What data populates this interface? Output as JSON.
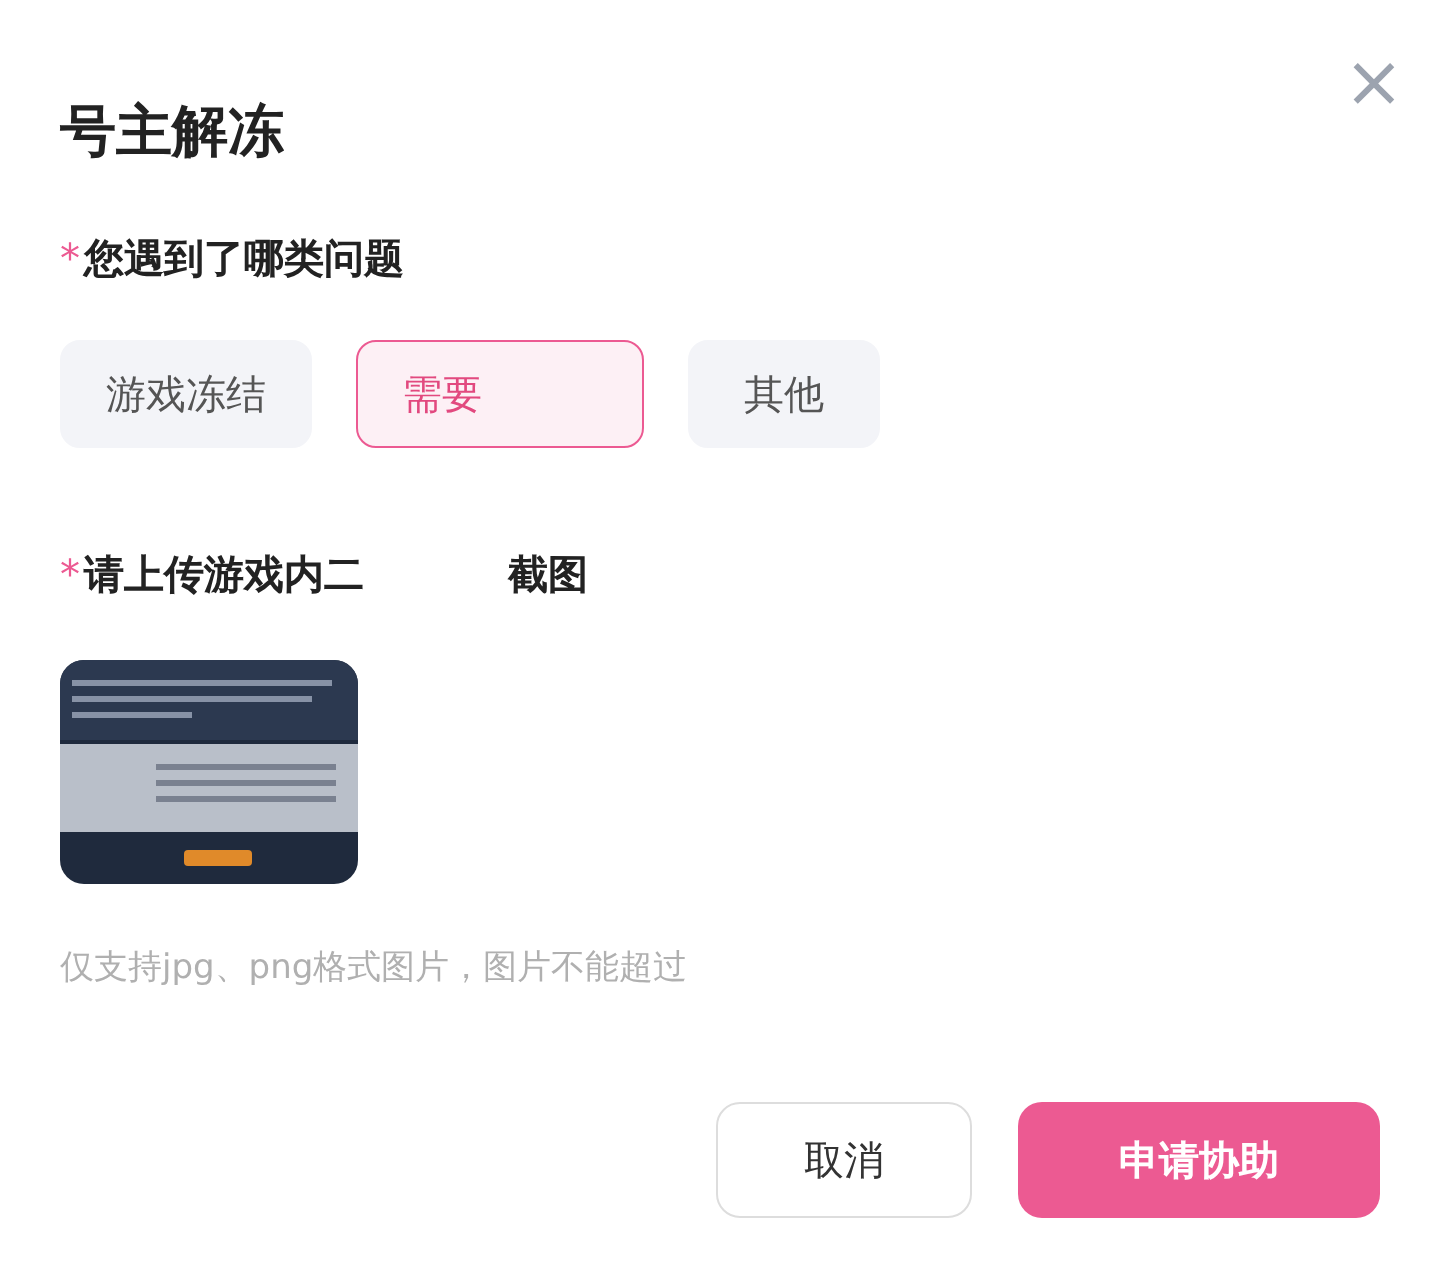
{
  "dialog": {
    "title": "号主解冻",
    "close": "×"
  },
  "question": {
    "marker": "*",
    "label": "您遇到了哪类问题",
    "options": [
      {
        "label": "游戏冻结",
        "selected": false
      },
      {
        "label": "需要",
        "selected": true
      },
      {
        "label": "其他",
        "selected": false
      }
    ]
  },
  "upload": {
    "marker": "*",
    "label_parts": [
      "请上传游戏内二",
      "截图"
    ],
    "thumbnail": {
      "kind": "picture"
    },
    "hint": "仅支持jpg、png格式图片，图片不能超过"
  },
  "buttons": [
    {
      "label": "取消",
      "kind": "secondary"
    },
    {
      "label": "申请协助",
      "kind": "primary"
    }
  ]
}
